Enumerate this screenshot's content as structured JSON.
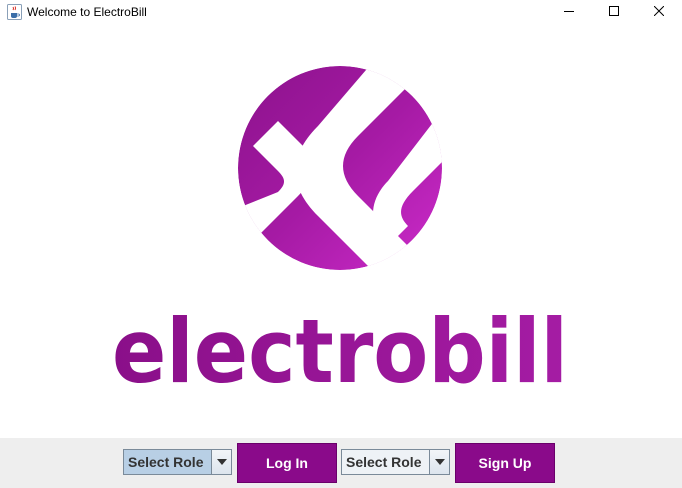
{
  "window": {
    "title": "Welcome to ElectroBill",
    "icon": "java-cup-icon",
    "controls": [
      "minimize-icon",
      "maximize-icon",
      "close-icon"
    ]
  },
  "logo": {
    "wordmark": "electrobill",
    "mark": "circle-s-logo",
    "colors": {
      "primary": "#a0189f",
      "light": "#c82ac6",
      "dark": "#7d0d7c"
    }
  },
  "actions": {
    "login_role_select": "Select Role",
    "login_label": "Log In",
    "signup_role_select": "Select Role",
    "signup_label": "Sign Up"
  },
  "colors": {
    "button": "#8a0a8a",
    "panel": "#eeeeee"
  }
}
